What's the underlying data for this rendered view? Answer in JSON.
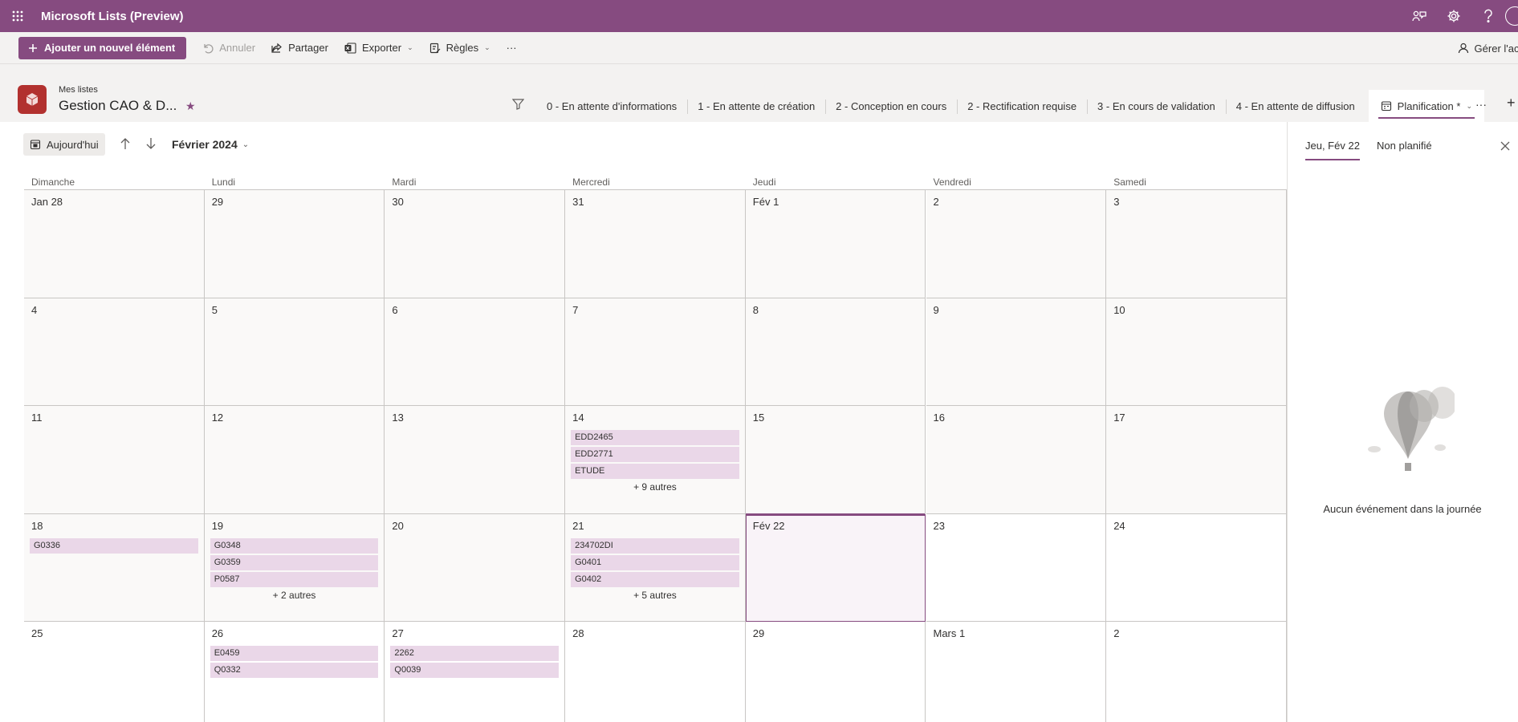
{
  "app": {
    "title": "Microsoft Lists (Preview)"
  },
  "commandbar": {
    "add_label": "Ajouter un nouvel élément",
    "undo_label": "Annuler",
    "share_label": "Partager",
    "export_label": "Exporter",
    "rules_label": "Règles",
    "more_label": "···",
    "manage_label": "Gérer l'acc"
  },
  "list": {
    "breadcrumb": "Mes listes",
    "name": "Gestion CAO & D...",
    "favorite_star": "★"
  },
  "views": [
    {
      "label": "0 - En attente d'informations"
    },
    {
      "label": "1 - En attente de création"
    },
    {
      "label": "2 - Conception en cours"
    },
    {
      "label": "2 - Rectification requise"
    },
    {
      "label": "3 - En cours de validation"
    },
    {
      "label": "4 - En attente de diffusion"
    }
  ],
  "active_view": {
    "label": "Planification *"
  },
  "views_more": "···",
  "views_add": "+",
  "calendar": {
    "today_label": "Aujourd'hui",
    "month_label": "Février 2024",
    "weekdays": [
      "Dimanche",
      "Lundi",
      "Mardi",
      "Mercredi",
      "Jeudi",
      "Vendredi",
      "Samedi"
    ],
    "weeks": [
      [
        {
          "label": "Jan 28",
          "events": []
        },
        {
          "label": "29",
          "events": []
        },
        {
          "label": "30",
          "events": []
        },
        {
          "label": "31",
          "events": []
        },
        {
          "label": "Fév 1",
          "events": []
        },
        {
          "label": "2",
          "events": []
        },
        {
          "label": "3",
          "events": []
        }
      ],
      [
        {
          "label": "4",
          "events": []
        },
        {
          "label": "5",
          "events": []
        },
        {
          "label": "6",
          "events": []
        },
        {
          "label": "7",
          "events": []
        },
        {
          "label": "8",
          "events": []
        },
        {
          "label": "9",
          "events": []
        },
        {
          "label": "10",
          "events": []
        }
      ],
      [
        {
          "label": "11",
          "events": []
        },
        {
          "label": "12",
          "events": []
        },
        {
          "label": "13",
          "events": []
        },
        {
          "label": "14",
          "events": [
            "EDD2465",
            "EDD2771",
            "ETUDE"
          ],
          "more": "+ 9 autres"
        },
        {
          "label": "15",
          "events": []
        },
        {
          "label": "16",
          "events": []
        },
        {
          "label": "17",
          "events": []
        }
      ],
      [
        {
          "label": "18",
          "events": [
            "G0336"
          ]
        },
        {
          "label": "19",
          "events": [
            "G0348",
            "G0359",
            "P0587"
          ],
          "more": "+ 2 autres"
        },
        {
          "label": "20",
          "events": []
        },
        {
          "label": "21",
          "events": [
            "234702DI",
            "G0401",
            "G0402"
          ],
          "more": "+ 5 autres"
        },
        {
          "label": "Fév 22",
          "events": [],
          "today": true
        },
        {
          "label": "23",
          "events": [],
          "future": true
        },
        {
          "label": "24",
          "events": [],
          "future": true
        }
      ],
      [
        {
          "label": "25",
          "events": [],
          "future": true
        },
        {
          "label": "26",
          "events": [
            "E0459",
            "Q0332"
          ],
          "future": true
        },
        {
          "label": "27",
          "events": [
            "2262",
            "Q0039"
          ],
          "future": true
        },
        {
          "label": "28",
          "events": [],
          "future": true
        },
        {
          "label": "29",
          "events": [],
          "future": true
        },
        {
          "label": "Mars 1",
          "events": [],
          "future": true
        },
        {
          "label": "2",
          "events": [],
          "future": true
        }
      ]
    ]
  },
  "panel": {
    "tab_day": "Jeu, Fév 22",
    "tab_unplanned": "Non planifié",
    "empty_message": "Aucun événement dans la journée"
  },
  "colors": {
    "brand": "#864b80",
    "event_bg": "#ead7e8",
    "list_icon": "#b2312f"
  }
}
